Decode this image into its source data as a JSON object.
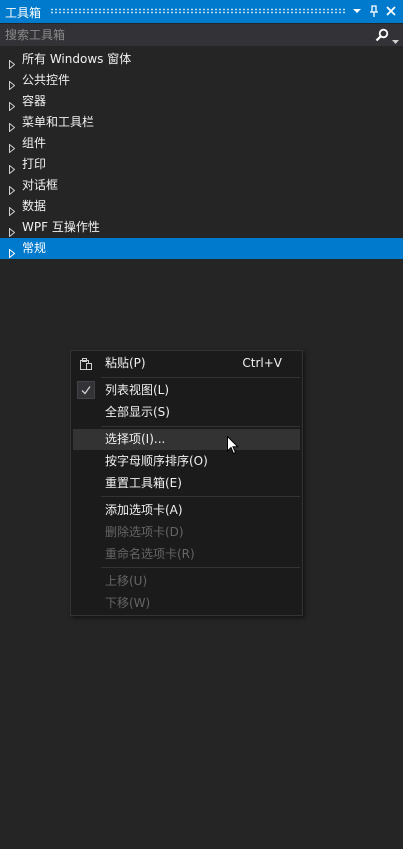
{
  "window": {
    "title": "工具箱"
  },
  "search": {
    "placeholder": "搜索工具箱"
  },
  "categories": [
    {
      "label": "所有 Windows 窗体"
    },
    {
      "label": "公共控件"
    },
    {
      "label": "容器"
    },
    {
      "label": "菜单和工具栏"
    },
    {
      "label": "组件"
    },
    {
      "label": "打印"
    },
    {
      "label": "对话框"
    },
    {
      "label": "数据"
    },
    {
      "label": "WPF 互操作性"
    },
    {
      "label": "常规"
    }
  ],
  "selected_category": "常规",
  "context_menu": {
    "paste": {
      "label": "粘贴(P)",
      "shortcut": "Ctrl+V"
    },
    "list_view": {
      "label": "列表视图(L)",
      "checked": true
    },
    "show_all": {
      "label": "全部显示(S)"
    },
    "choose_items": {
      "label": "选择项(I)..."
    },
    "sort_alpha": {
      "label": "按字母顺序排序(O)"
    },
    "reset_toolbox": {
      "label": "重置工具箱(E)"
    },
    "add_tab": {
      "label": "添加选项卡(A)"
    },
    "delete_tab": {
      "label": "删除选项卡(D)"
    },
    "rename_tab": {
      "label": "重命名选项卡(R)"
    },
    "move_up": {
      "label": "上移(U)"
    },
    "move_down": {
      "label": "下移(W)"
    }
  },
  "colors": {
    "accent": "#007acc",
    "background": "#252526",
    "menu_bg": "#1b1b1c",
    "disabled_text": "#656565"
  }
}
